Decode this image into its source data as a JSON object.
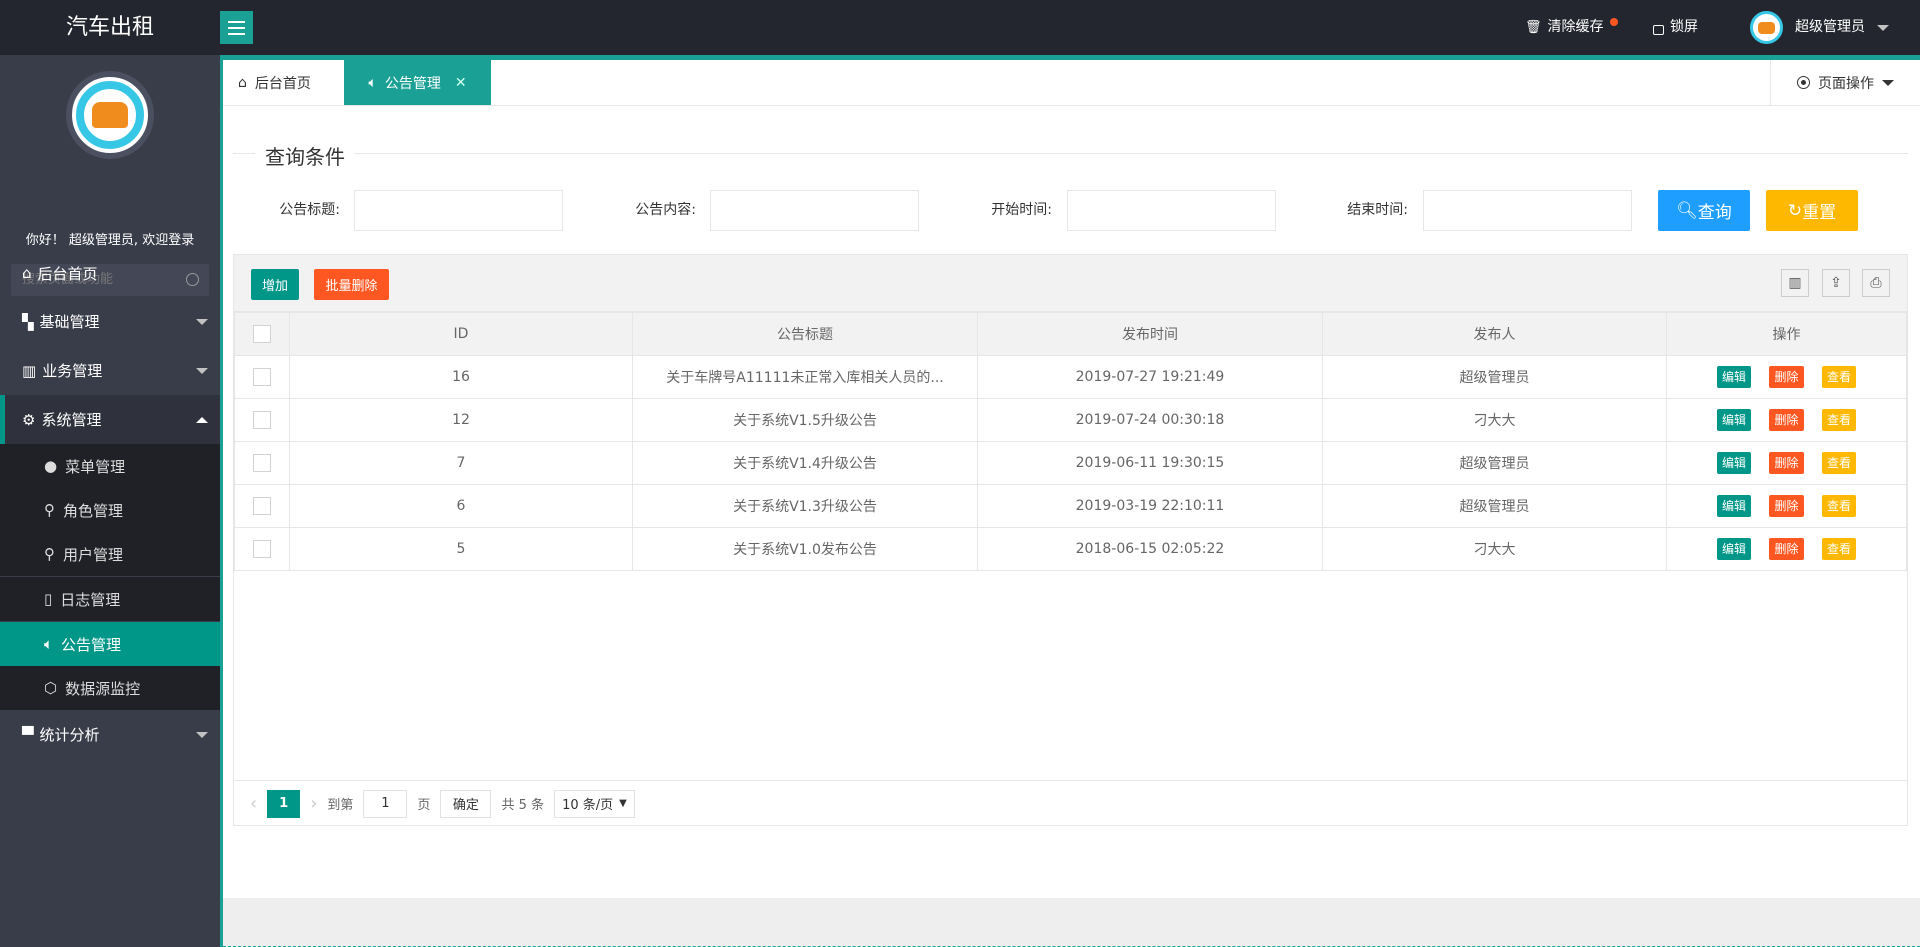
{
  "app": {
    "title": "汽车出租"
  },
  "header": {
    "clear_cache": "清除缓存",
    "lock": "锁屏",
    "user": "超级管理员"
  },
  "sidebar": {
    "greeting": "你好！ 超级管理员, 欢迎登录",
    "search_placeholder": "搜索页面或功能",
    "items": [
      {
        "label": "后台首页"
      },
      {
        "label": "基础管理"
      },
      {
        "label": "业务管理"
      },
      {
        "label": "系统管理"
      },
      {
        "label": "统计分析"
      }
    ],
    "sub_items": [
      {
        "label": "菜单管理"
      },
      {
        "label": "角色管理"
      },
      {
        "label": "用户管理"
      },
      {
        "label": "日志管理"
      },
      {
        "label": "公告管理"
      },
      {
        "label": "数据源监控"
      }
    ]
  },
  "tabs": {
    "home": "后台首页",
    "active": "公告管理",
    "page_ops": "页面操作"
  },
  "search": {
    "legend": "查询条件",
    "title_label": "公告标题:",
    "content_label": "公告内容:",
    "start_label": "开始时间:",
    "end_label": "结束时间:",
    "query": "查询",
    "reset": "重置"
  },
  "toolbar": {
    "add": "增加",
    "batch_delete": "批量删除"
  },
  "table": {
    "columns": [
      "ID",
      "公告标题",
      "发布时间",
      "发布人",
      "操作"
    ],
    "actions": {
      "edit": "编辑",
      "delete": "删除",
      "view": "查看"
    },
    "rows": [
      {
        "id": "16",
        "title": "关于车牌号A11111未正常入库相关人员的...",
        "time": "2019-07-27 19:21:49",
        "publisher": "超级管理员"
      },
      {
        "id": "12",
        "title": "关于系统V1.5升级公告",
        "time": "2019-07-24 00:30:18",
        "publisher": "刁大大"
      },
      {
        "id": "7",
        "title": "关于系统V1.4升级公告",
        "time": "2019-06-11 19:30:15",
        "publisher": "超级管理员"
      },
      {
        "id": "6",
        "title": "关于系统V1.3升级公告",
        "time": "2019-03-19 22:10:11",
        "publisher": "超级管理员"
      },
      {
        "id": "5",
        "title": "关于系统V1.0发布公告",
        "time": "2018-06-15 02:05:22",
        "publisher": "刁大大"
      }
    ]
  },
  "pager": {
    "current": "1",
    "goto": "到第",
    "page_input": "1",
    "page_unit": "页",
    "confirm": "确定",
    "total": "共 5 条",
    "page_size": "10 条/页"
  },
  "colors": {
    "teal": "#009688",
    "blue": "#1E9FFF",
    "orange": "#FFB800",
    "red": "#FF5722",
    "dark": "#23262e"
  }
}
